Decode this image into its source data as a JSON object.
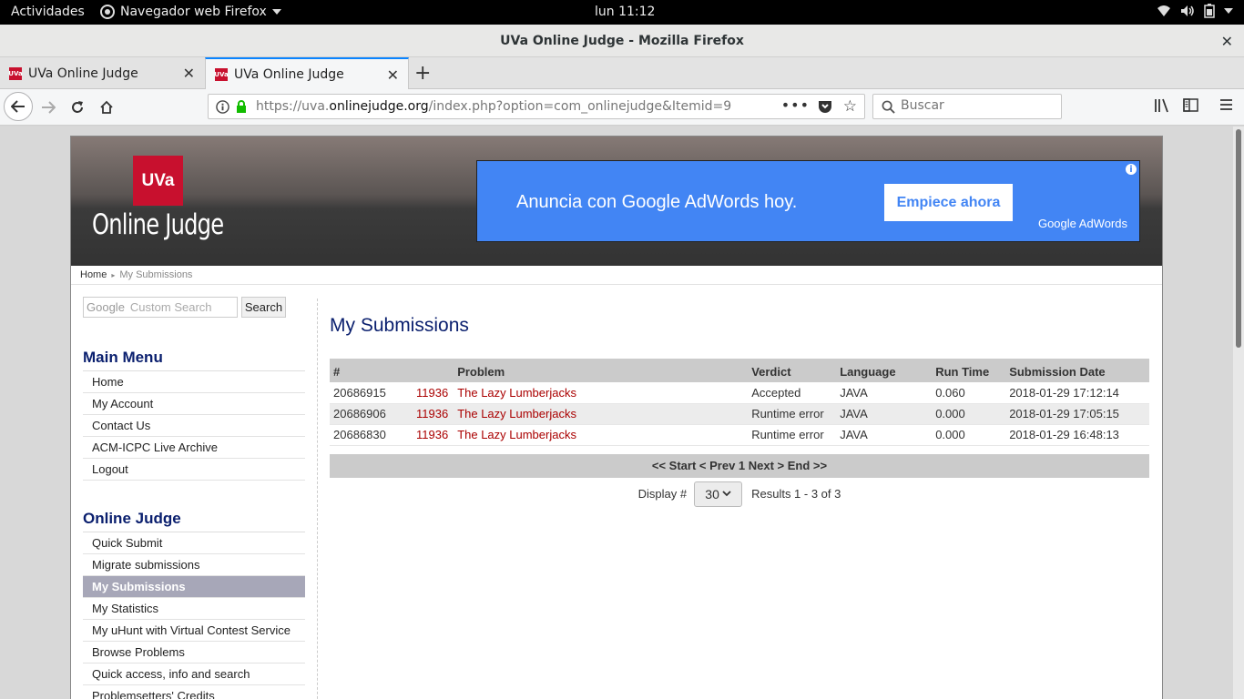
{
  "os": {
    "activities": "Actividades",
    "app_name": "Navegador web Firefox",
    "clock": "lun 11:12"
  },
  "window": {
    "title": "UVa Online Judge - Mozilla Firefox"
  },
  "tabs": [
    {
      "label": "UVa Online Judge"
    },
    {
      "label": "UVa Online Judge"
    }
  ],
  "navbar": {
    "url_prefix": "https://uva.",
    "url_domain": "onlinejudge.org",
    "url_path": "/index.php?option=com_onlinejudge&Itemid=9",
    "search_placeholder": "Buscar"
  },
  "site": {
    "logo_badge": "UVa",
    "logo_text": "Online Judge",
    "ad": {
      "headline": "Anuncia con Google AdWords hoy.",
      "cta": "Empiece ahora",
      "brand": "Google AdWords",
      "info": "i"
    },
    "breadcrumb": {
      "home": "Home",
      "separator": "▸",
      "current": "My Submissions"
    },
    "gsearch": {
      "google": "Google",
      "placeholder": "Custom Search",
      "button": "Search"
    },
    "main_menu": {
      "title": "Main Menu",
      "items": [
        "Home",
        "My Account",
        "Contact Us",
        "ACM-ICPC Live Archive",
        "Logout"
      ]
    },
    "oj_menu": {
      "title": "Online Judge",
      "items": [
        "Quick Submit",
        "Migrate submissions",
        "My Submissions",
        "My Statistics",
        "My uHunt with Virtual Contest Service",
        "Browse Problems",
        "Quick access, info and search",
        "Problemsetters' Credits"
      ]
    }
  },
  "main": {
    "title": "My Submissions",
    "columns": [
      "#",
      "",
      "Problem",
      "Verdict",
      "Language",
      "Run Time",
      "Submission Date"
    ],
    "rows": [
      {
        "id": "20686915",
        "pid": "11936",
        "problem": "The Lazy Lumberjacks",
        "verdict": "Accepted",
        "language": "JAVA",
        "runtime": "0.060",
        "date": "2018-01-29 17:12:14"
      },
      {
        "id": "20686906",
        "pid": "11936",
        "problem": "The Lazy Lumberjacks",
        "verdict": "Runtime error",
        "language": "JAVA",
        "runtime": "0.000",
        "date": "2018-01-29 17:05:15"
      },
      {
        "id": "20686830",
        "pid": "11936",
        "problem": "The Lazy Lumberjacks",
        "verdict": "Runtime error",
        "language": "JAVA",
        "runtime": "0.000",
        "date": "2018-01-29 16:48:13"
      }
    ],
    "pager": "<< Start < Prev 1 Next > End >>",
    "display_label": "Display #",
    "display_value": "30",
    "results": "Results 1 - 3 of 3"
  }
}
